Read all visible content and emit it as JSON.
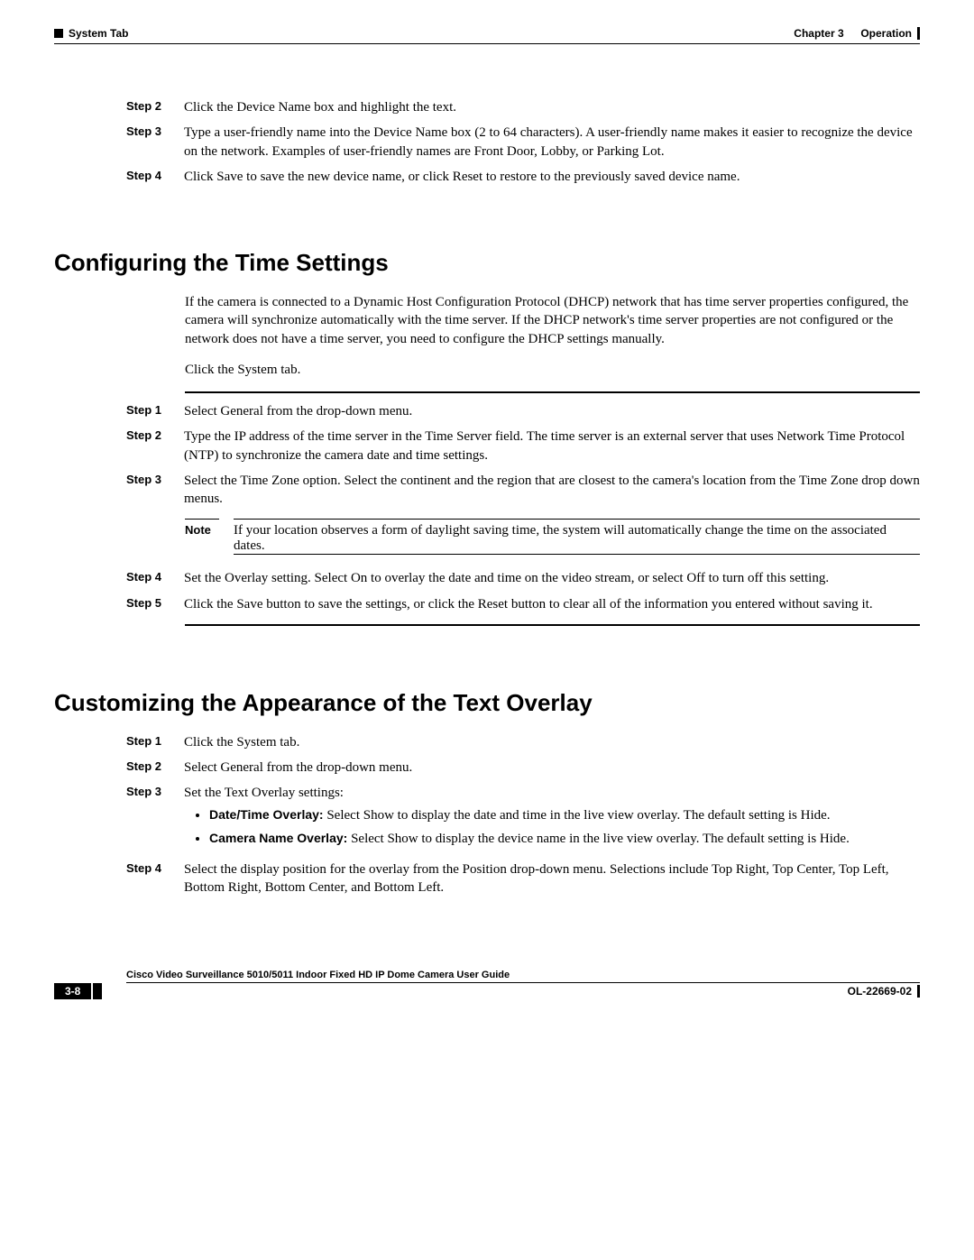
{
  "header": {
    "left": "System Tab",
    "right_chapter": "Chapter 3",
    "right_title": "Operation"
  },
  "steps_top": [
    {
      "label": "Step 2",
      "text": "Click the Device Name box and highlight the text."
    },
    {
      "label": "Step 3",
      "text": "Type a user-friendly name into the Device Name box (2 to 64 characters). A user-friendly name makes it easier to recognize the device on the network. Examples of user-friendly names are Front Door, Lobby, or Parking Lot."
    },
    {
      "label": "Step 4",
      "text": "Click Save to save the new device name, or click Reset to restore to the previously saved device name."
    }
  ],
  "section1": {
    "heading": "Configuring the Time Settings",
    "intro1": "If the camera is connected to a Dynamic Host Configuration Protocol (DHCP) network that has time server properties configured, the camera will synchronize automatically with the time server. If the DHCP network's time server properties are not configured or the network does not have a time server, you need to configure the DHCP settings manually.",
    "intro2": "Click the System tab.",
    "steps": [
      {
        "label": "Step 1",
        "text": "Select General from the drop-down menu."
      },
      {
        "label": "Step 2",
        "text": "Type the IP address of the time server in the Time Server field. The time server is an external server that uses Network Time Protocol (NTP) to synchronize the camera date and time settings."
      },
      {
        "label": "Step 3",
        "text": "Select the Time Zone option. Select the continent and the region that are closest to the camera's location from the Time Zone drop down menus."
      },
      {
        "label": "Step 4",
        "text": "Set the Overlay setting. Select On to overlay the date and time on the video stream, or select Off to turn off this setting."
      },
      {
        "label": "Step 5",
        "text": "Click the Save button to save the settings, or click the Reset button to clear all of the information you entered without saving it."
      }
    ],
    "note_label": "Note",
    "note_text": "If your location observes a form of daylight saving time, the system will automatically change the time on the associated dates."
  },
  "section2": {
    "heading": "Customizing the Appearance of the Text Overlay",
    "steps": [
      {
        "label": "Step 1",
        "text": "Click the System tab."
      },
      {
        "label": "Step 2",
        "text": "Select General from the drop-down menu."
      },
      {
        "label": "Step 3",
        "text": "Set the Text Overlay settings:"
      },
      {
        "label": "Step 4",
        "text": "Select the display position for the overlay from the Position drop-down menu. Selections include Top Right, Top Center, Top Left, Bottom Right, Bottom Center, and Bottom Left."
      }
    ],
    "bullets": [
      {
        "bold": "Date/Time Overlay:",
        "rest": " Select Show to display the date and time in the live view overlay. The default setting is Hide."
      },
      {
        "bold": "Camera Name Overlay:",
        "rest": " Select Show to display the device name in the live view overlay. The default setting is Hide."
      }
    ]
  },
  "footer": {
    "guide": "Cisco Video Surveillance 5010/5011 Indoor Fixed HD IP Dome Camera User Guide",
    "page": "3-8",
    "docid": "OL-22669-02"
  }
}
